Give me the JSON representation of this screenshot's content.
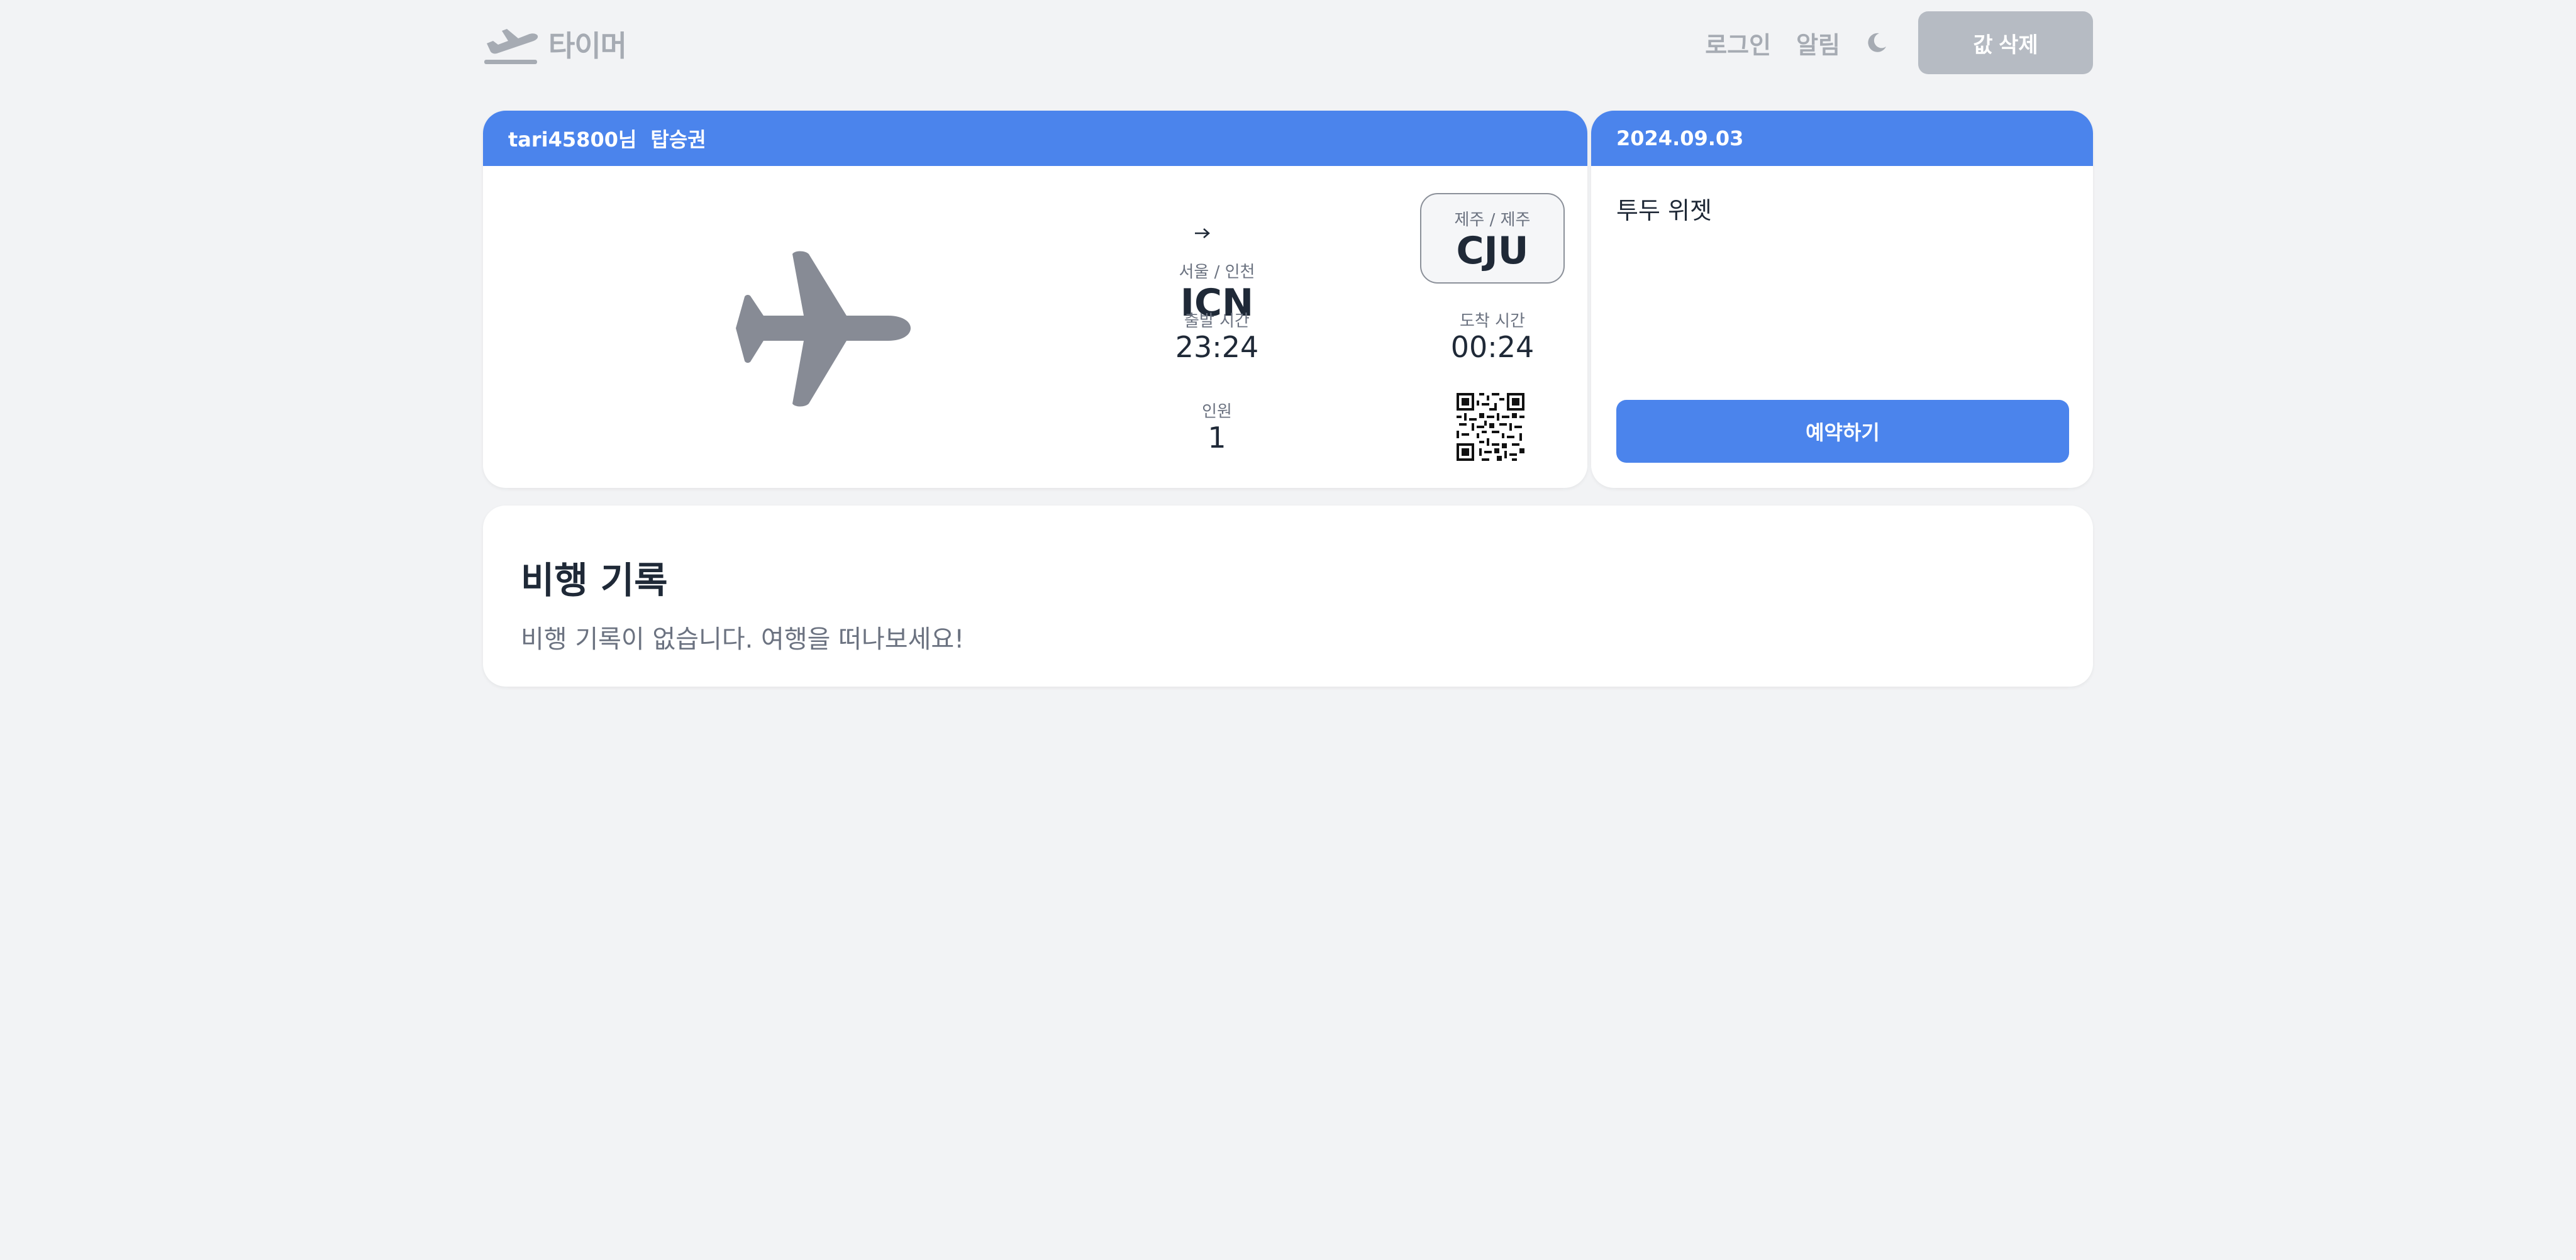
{
  "header": {
    "logo_text": "타이머",
    "nav": {
      "login": "로그인",
      "alerts": "알림"
    },
    "delete_button": "값 삭제"
  },
  "boarding_pass": {
    "user": "tari45800님",
    "title": "탑승권",
    "origin": {
      "city": "서울 / 인천",
      "code": "ICN"
    },
    "destination": {
      "city": "제주 / 제주",
      "code": "CJU"
    },
    "departure": {
      "label": "출발 시간",
      "time": "23:24"
    },
    "arrival": {
      "label": "도착 시간",
      "time": "00:24"
    },
    "passengers": {
      "label": "인원",
      "count": "1"
    }
  },
  "todo": {
    "date": "2024.09.03",
    "title": "투두 위젯",
    "reserve_button": "예약하기"
  },
  "flight_log": {
    "title": "비행 기록",
    "empty_message": "비행 기록이 없습니다. 여행을 떠나보세요!"
  },
  "colors": {
    "accent": "#4b84ec",
    "muted": "#a6abb3",
    "background": "#f2f3f5"
  }
}
